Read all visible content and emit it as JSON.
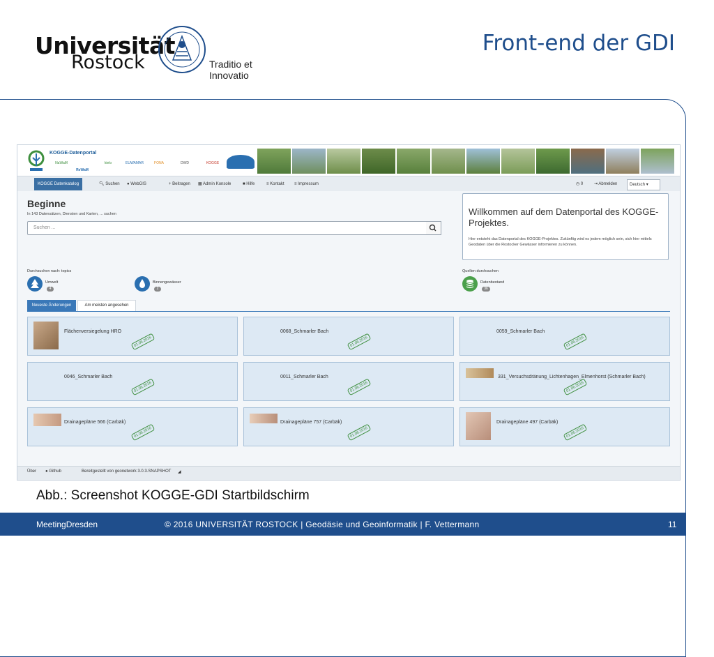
{
  "slide": {
    "logo_word1": "Universität",
    "logo_word2": "Rostock",
    "motto": "Traditio et Innovatio",
    "title": "Front-end der GDI",
    "caption": "Abb.: Screenshot KOGGE-GDI Startbildschirm",
    "footer_left": "MeetingDresden",
    "footer_mid": "© 2016 UNIVERSITÄT ROSTOCK | Geodäsie und Geoinformatik | F. Vettermann",
    "page_number": "11"
  },
  "portal": {
    "title": "KOGGE-Datenportal",
    "partners": [
      "NaWaM",
      "ReWaM",
      "kielo",
      "EUWAMAR",
      "FONA",
      "DWD",
      "KOGGE"
    ],
    "nav": {
      "catalog": "KOGGE Datenkatalog",
      "search": "Suchen",
      "webgis": "WebGIS",
      "contribute": "Beitragen",
      "admin": "Admin Konsole",
      "help": "Hilfe",
      "contact": "Kontakt",
      "imprint": "Impressum",
      "counter": "0",
      "logout": "Abmelden",
      "language": "Deutsch"
    },
    "heading": "Beginne",
    "subline": "In 143 Datensätzen, Diensten und Karten, ... suchen",
    "search_placeholder": "Suchen ...",
    "welcome_title": "Willkommen auf dem Datenportal des KOGGE-Projektes.",
    "welcome_text": "Hier entsteht das Datenportal des KOGGE-Projektes. Zukünftig wird es jedem möglich sein, sich hier mittels Geodaten über die Rostocker Gewässer informieren zu können.",
    "browse_label": "Durchsuchen nach: topics",
    "topics": [
      {
        "label": "Umwelt",
        "count": "4"
      },
      {
        "label": "Binnengewässer",
        "count": "2"
      }
    ],
    "sources_label": "Quellen durchsuchen",
    "source": {
      "label": "Datenbestand",
      "count": "36"
    },
    "tabs": [
      "Neueste Änderungen",
      "Am meisten angesehen"
    ],
    "stamp": "01.06.2016",
    "cards": [
      {
        "title": "Flächenversiegelung HRO"
      },
      {
        "title": "0068_Schmarler Bach"
      },
      {
        "title": "0059_Schmarler Bach"
      },
      {
        "title": "0046_Schmarler Bach"
      },
      {
        "title": "0011_Schmarler Bach"
      },
      {
        "title": "331_Versuchsdränung_Lichtenhagen_Elmenhorst (Schmarler Bach)"
      },
      {
        "title": "Drainagepläne 566 (Carbäk)"
      },
      {
        "title": "Drainagepläne 757 (Carbäk)"
      },
      {
        "title": "Drainagepläne 497 (Carbäk)"
      }
    ],
    "footer": {
      "about": "Über",
      "github": "Github",
      "powered": "Bereitgestellt von geonetwork 3.0.3.SNAPSHOT"
    }
  },
  "colors": {
    "brand_blue": "#1f4e8c",
    "nav_active": "#3a6fa3",
    "card_bg": "#dde9f4",
    "stamp_green": "#3e8f3e"
  }
}
